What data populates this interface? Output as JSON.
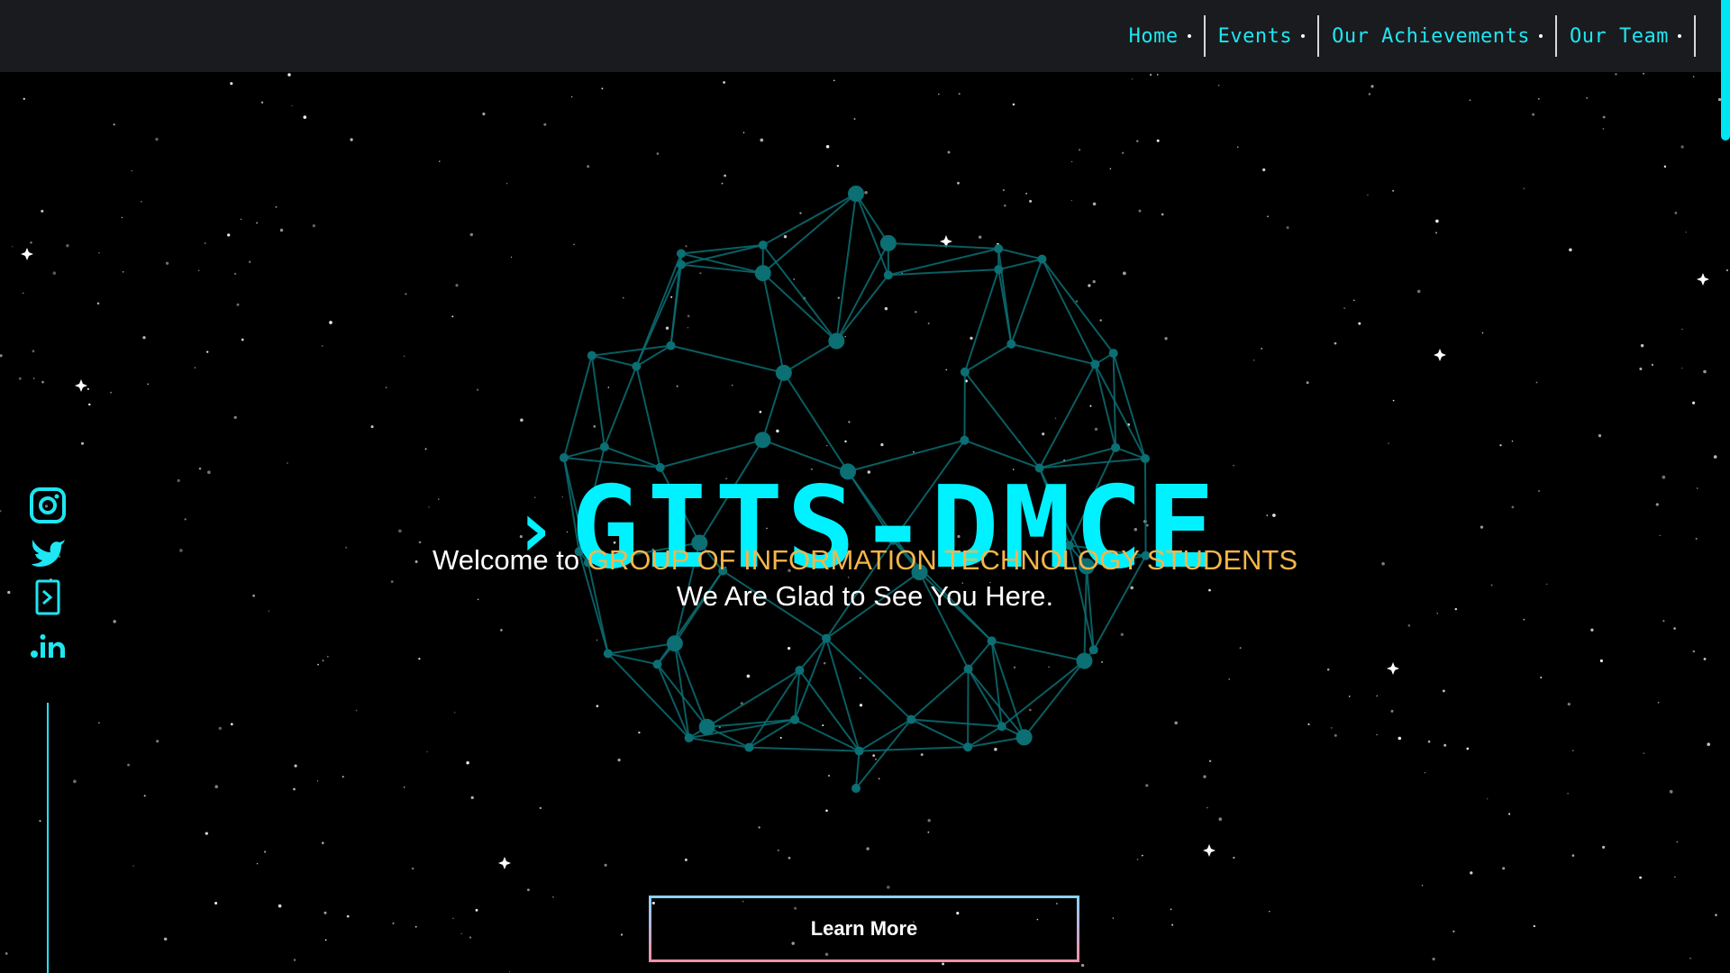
{
  "nav": {
    "items": [
      {
        "label": "Home"
      },
      {
        "label": "Events"
      },
      {
        "label": "Our Achievements"
      },
      {
        "label": "Our Team"
      }
    ]
  },
  "social": {
    "icons": [
      "instagram-icon",
      "twitter-icon",
      "terminal-icon",
      "linkedin-icon"
    ]
  },
  "hero": {
    "prompt": "›",
    "title": "GITS-DMCE",
    "welcome_prefix": "Welcome to ",
    "welcome_highlight": "GROUP OF INFORMATION TECHNOLOGY STUDENTS",
    "tagline": "We Are Glad to See You Here.",
    "cta_label": "Learn More"
  },
  "colors": {
    "accent": "#00f1ff",
    "highlight": "#f6b649",
    "navbar_bg": "#1a1b1e",
    "background": "#000000",
    "globe": "#0b6f74"
  }
}
